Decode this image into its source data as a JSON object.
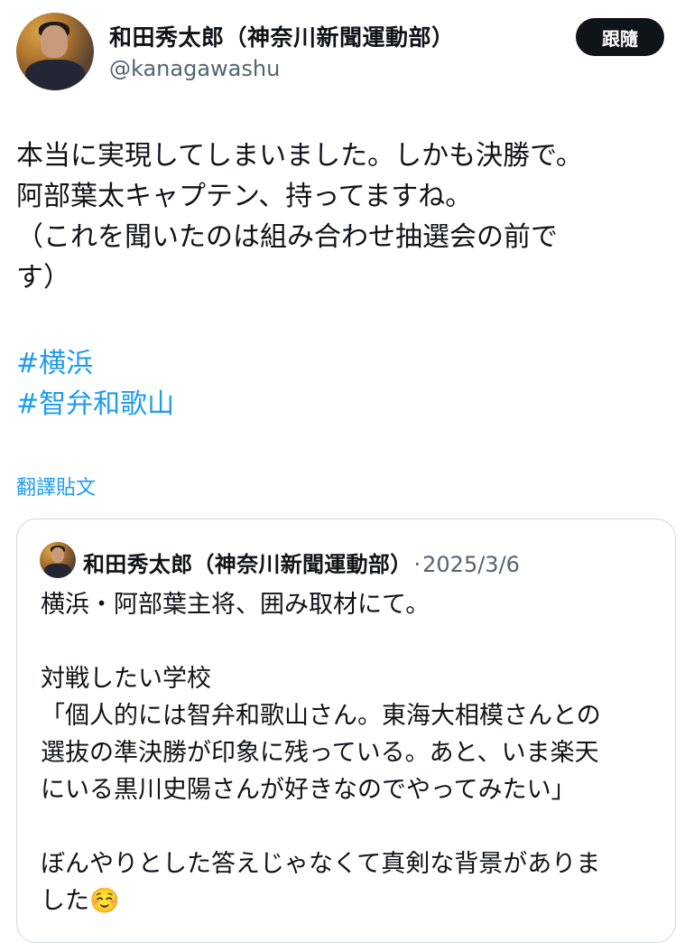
{
  "author": {
    "name": "和田秀太郎（神奈川新聞運動部）",
    "handle": "@kanagawashu",
    "avatar_icon": "user-avatar-icon"
  },
  "follow_label": "跟隨",
  "tweet": {
    "text": "本当に実現してしまいました。しかも決勝で。\n阿部葉太キャプテン、持ってますね。\n（これを聞いたのは組み合わせ抽選会の前で\nす）",
    "hashtags": [
      "#横浜",
      "#智弁和歌山"
    ]
  },
  "translate_label": "翻譯貼文",
  "quoted": {
    "name": "和田秀太郎（神奈川新聞運動部）",
    "separator": "·",
    "date": "2025/3/6",
    "text": "横浜・阿部葉主将、囲み取材にて。\n\n対戦したい学校\n「個人的には智弁和歌山さん。東海大相模さんとの\n選抜の準決勝が印象に残っている。あと、いま楽天\nにいる黒川史陽さんが好きなのでやってみたい」\n\nぼんやりとした答えじゃなくて真剣な背景がありま\nした☺️"
  },
  "colors": {
    "link": "#1d9bf0",
    "text": "#0f1419",
    "secondary": "#536471",
    "border": "#cfd9de",
    "button_bg": "#0f1419"
  }
}
